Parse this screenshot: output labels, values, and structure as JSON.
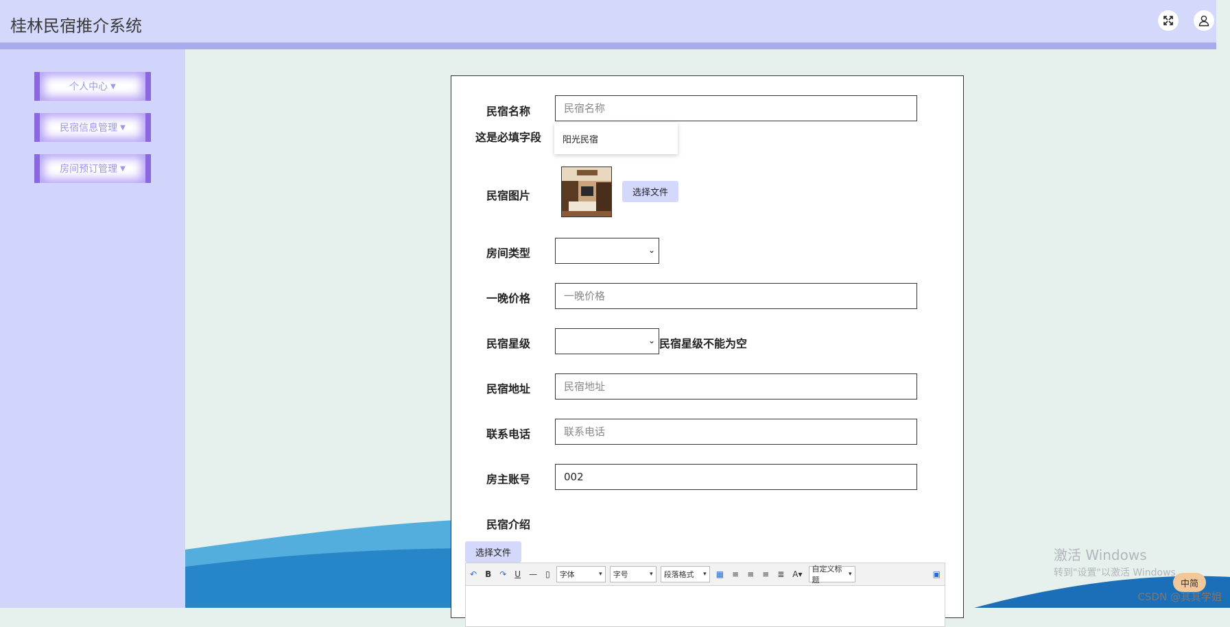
{
  "app": {
    "title": "桂林民宿推介系统"
  },
  "header": {
    "fullscreen_icon": "expand-icon",
    "user_icon": "user-icon"
  },
  "sidebar": {
    "items": [
      {
        "label": "个人中心"
      },
      {
        "label": "民宿信息管理"
      },
      {
        "label": "房间预订管理"
      }
    ]
  },
  "form": {
    "name": {
      "label": "民宿名称",
      "placeholder": "民宿名称",
      "required_msg": "这是必填字段",
      "suggestion": "阳光民宿"
    },
    "image": {
      "label": "民宿图片",
      "button": "选择文件"
    },
    "room_type": {
      "label": "房间类型",
      "value": ""
    },
    "price": {
      "label": "一晚价格",
      "placeholder": "一晚价格"
    },
    "stars": {
      "label": "民宿星级",
      "value": "",
      "error": "民宿星级不能为空"
    },
    "address": {
      "label": "民宿地址",
      "placeholder": "民宿地址"
    },
    "phone": {
      "label": "联系电话",
      "placeholder": "联系电话"
    },
    "owner": {
      "label": "房主账号",
      "value": "002"
    },
    "intro": {
      "label": "民宿介绍",
      "button": "选择文件",
      "toolbar": {
        "font": "字体",
        "size": "字号",
        "paragraph": "段落格式",
        "custom_title": "自定义标题"
      }
    }
  },
  "overlay": {
    "activate_line1": "激活 Windows",
    "activate_line2": "转到\"设置\"以激活 Windows",
    "ime": "中简",
    "csdn": "CSDN @其其学姐"
  },
  "colors": {
    "header_bg": "#d4d8fb",
    "sidebar_bg": "#d1d4fb",
    "accent": "#8c68e0",
    "page_bg": "#e6f0ec"
  }
}
